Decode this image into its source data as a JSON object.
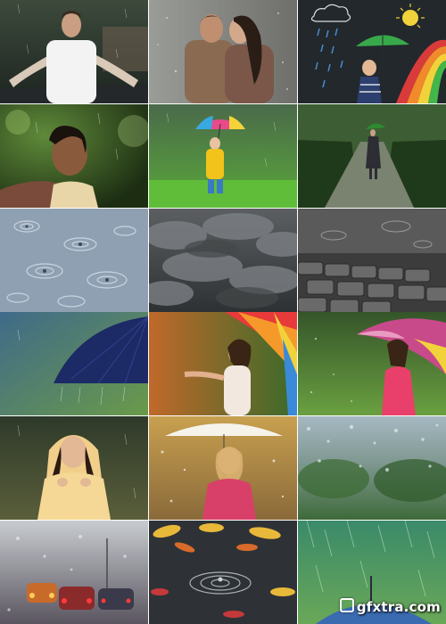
{
  "collage": {
    "tiles": [
      {
        "subject": "man-in-rain"
      },
      {
        "subject": "couple-in-rain"
      },
      {
        "subject": "boy-with-umbrella-drawing"
      },
      {
        "subject": "girl-in-rain"
      },
      {
        "subject": "child-yellow-raincoat"
      },
      {
        "subject": "woman-on-rainy-road"
      },
      {
        "subject": "raindrop-ripples"
      },
      {
        "subject": "storm-clouds"
      },
      {
        "subject": "wet-cobblestones"
      },
      {
        "subject": "blue-umbrella"
      },
      {
        "subject": "woman-rainbow-umbrella"
      },
      {
        "subject": "woman-pink-dress-umbrella"
      },
      {
        "subject": "girl-hooded-raincoat"
      },
      {
        "subject": "woman-white-umbrella"
      },
      {
        "subject": "rain-on-window"
      },
      {
        "subject": "traffic-through-wet-glass"
      },
      {
        "subject": "water-drop-ripple"
      },
      {
        "subject": "umbrella-in-green-rain"
      }
    ]
  },
  "watermark": {
    "text": "gfxtra.com"
  }
}
